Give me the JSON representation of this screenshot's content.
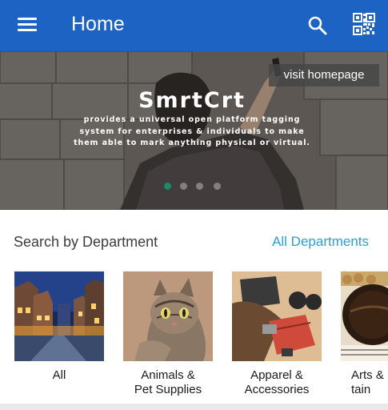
{
  "appbar": {
    "title": "Home",
    "menu_icon": "menu-icon",
    "search_icon": "search-icon",
    "qr_icon": "qr-code-icon",
    "color": "#1c63c4"
  },
  "banner": {
    "visit_label": "visit homepage",
    "brand": "SmrtCrt",
    "tagline": "provides a universal open platform tagging system for enterprises & individuals to make them able to mark anything physical or virtual.",
    "slide_count": 4,
    "active_slide": 0,
    "active_dot_color": "#1a8a6a"
  },
  "departments": {
    "heading": "Search by Department",
    "all_link": "All Departments",
    "link_color": "#2a9fd8",
    "items": [
      {
        "label": "All"
      },
      {
        "label": "Animals &\nPet Supplies"
      },
      {
        "label": "Apparel &\nAccessories"
      },
      {
        "label": "Arts &\ntain"
      }
    ]
  }
}
